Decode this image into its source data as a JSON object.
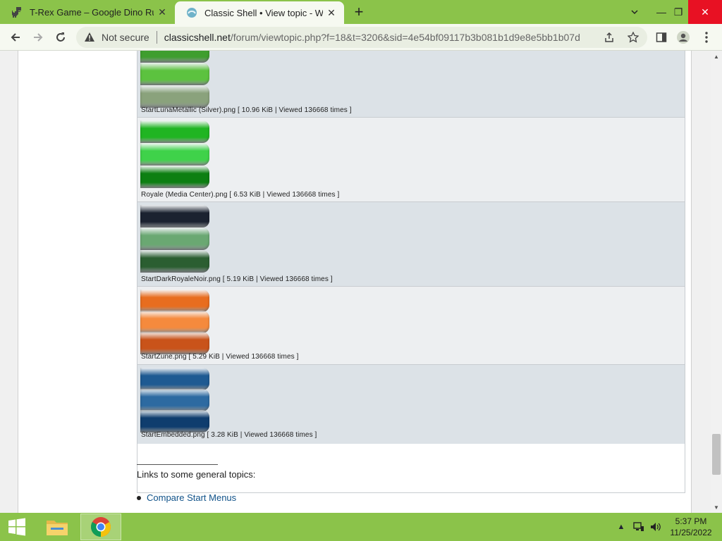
{
  "browser": {
    "tabs": [
      {
        "title": "T-Rex Game – Google Dino Run",
        "icon": "dino-icon",
        "active": false
      },
      {
        "title": "Classic Shell • View topic - Windows",
        "icon": "classic-shell-icon",
        "active": true
      }
    ],
    "new_tab": "+",
    "window_controls": {
      "minimize": "—",
      "restore": "❐",
      "close": "✕"
    },
    "address": {
      "security_label": "Not secure",
      "host": "classicshell.net",
      "path": "/forum/viewtopic.php?f=18&t=3206&sid=4e54bf09117b3b081b1d9e8e5bb1b07d"
    }
  },
  "attachments": [
    {
      "caption": "StartLunaMetallic (Silver).png [ 10.96 KiB | Viewed 136668 times ]",
      "colors": [
        "#3f9e2e",
        "#5cc23f",
        "#8aa27c"
      ]
    },
    {
      "caption": "Royale (Media Center).png [ 6.53 KiB | Viewed 136668 times ]",
      "colors": [
        "#20b522",
        "#3fd24a",
        "#0d7f12"
      ]
    },
    {
      "caption": "StartDarkRoyaleNoir.png [ 5.19 KiB | Viewed 136668 times ]",
      "colors": [
        "#1b2230",
        "#6aa872",
        "#2b5e31"
      ]
    },
    {
      "caption": "StartZune.png [ 5.29 KiB | Viewed 136668 times ]",
      "colors": [
        "#e86d1f",
        "#f58a3d",
        "#c9531a"
      ]
    },
    {
      "caption": "StartEmbedded.png [ 3.28 KiB | Viewed 136668 times ]",
      "colors": [
        "#1e5a92",
        "#2d6aa1",
        "#0f3d6e"
      ]
    }
  ],
  "links": {
    "heading": "Links to some general topics:",
    "items": [
      "Compare Start Menus"
    ]
  },
  "taskbar": {
    "clock_time": "5:37 PM",
    "clock_date": "11/25/2022"
  }
}
